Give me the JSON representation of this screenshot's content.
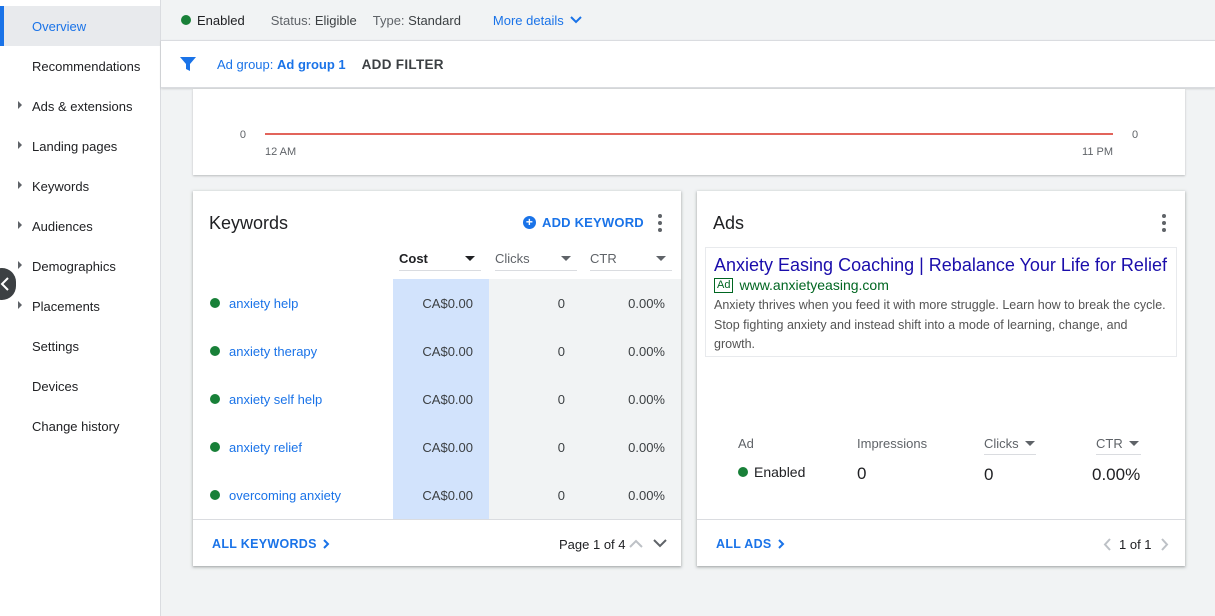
{
  "sidebar": {
    "items": [
      {
        "label": "Overview",
        "active": true,
        "expandable": false
      },
      {
        "label": "Recommendations",
        "active": false,
        "expandable": false
      },
      {
        "label": "Ads & extensions",
        "active": false,
        "expandable": true
      },
      {
        "label": "Landing pages",
        "active": false,
        "expandable": true
      },
      {
        "label": "Keywords",
        "active": false,
        "expandable": true
      },
      {
        "label": "Audiences",
        "active": false,
        "expandable": true
      },
      {
        "label": "Demographics",
        "active": false,
        "expandable": true
      },
      {
        "label": "Placements",
        "active": false,
        "expandable": true
      },
      {
        "label": "Settings",
        "active": false,
        "expandable": false
      },
      {
        "label": "Devices",
        "active": false,
        "expandable": false
      },
      {
        "label": "Change history",
        "active": false,
        "expandable": false
      }
    ]
  },
  "status_bar": {
    "enabled_label": "Enabled",
    "status_key": "Status:",
    "status_value": "Eligible",
    "type_key": "Type:",
    "type_value": "Standard",
    "more_details": "More details"
  },
  "filter_bar": {
    "chip_key": "Ad group:",
    "chip_value": "Ad group 1",
    "add_filter": "ADD FILTER"
  },
  "chart": {
    "y_left": "0",
    "y_right": "0",
    "x_start": "12 AM",
    "x_end": "11 PM"
  },
  "chart_data": {
    "type": "line",
    "x": [
      "12 AM",
      "11 PM"
    ],
    "series": [
      {
        "values": [
          0,
          0
        ]
      }
    ],
    "xlabel": "",
    "ylabel": "",
    "color": "#d93025"
  },
  "keywords": {
    "title": "Keywords",
    "add_label": "ADD KEYWORD",
    "columns": [
      "Cost",
      "Clicks",
      "CTR"
    ],
    "rows": [
      {
        "keyword": "anxiety help",
        "cost": "CA$0.00",
        "clicks": "0",
        "ctr": "0.00%"
      },
      {
        "keyword": "anxiety therapy",
        "cost": "CA$0.00",
        "clicks": "0",
        "ctr": "0.00%"
      },
      {
        "keyword": "anxiety self help",
        "cost": "CA$0.00",
        "clicks": "0",
        "ctr": "0.00%"
      },
      {
        "keyword": "anxiety relief",
        "cost": "CA$0.00",
        "clicks": "0",
        "ctr": "0.00%"
      },
      {
        "keyword": "overcoming anxiety",
        "cost": "CA$0.00",
        "clicks": "0",
        "ctr": "0.00%"
      }
    ],
    "all_link": "ALL KEYWORDS",
    "pager": "Page 1 of 4"
  },
  "ads": {
    "title": "Ads",
    "headline": "Anxiety Easing Coaching | Rebalance Your Life for Relief",
    "badge": "Ad",
    "url": "www.anxietyeasing.com",
    "description": "Anxiety thrives when you feed it with more struggle. Learn how to break the cycle. Stop fighting anxiety and instead shift into a mode of learning, change, and growth.",
    "stats": {
      "ad_label": "Ad",
      "ad_status": "Enabled",
      "impressions_label": "Impressions",
      "impressions_value": "0",
      "clicks_label": "Clicks",
      "clicks_value": "0",
      "ctr_label": "CTR",
      "ctr_value": "0.00%"
    },
    "all_link": "ALL ADS",
    "pager": "1 of 1"
  },
  "colors": {
    "accent": "#1a73e8",
    "enabled_green": "#188038",
    "chart_line": "#d93025",
    "sort_highlight": "#d2e3fc"
  }
}
